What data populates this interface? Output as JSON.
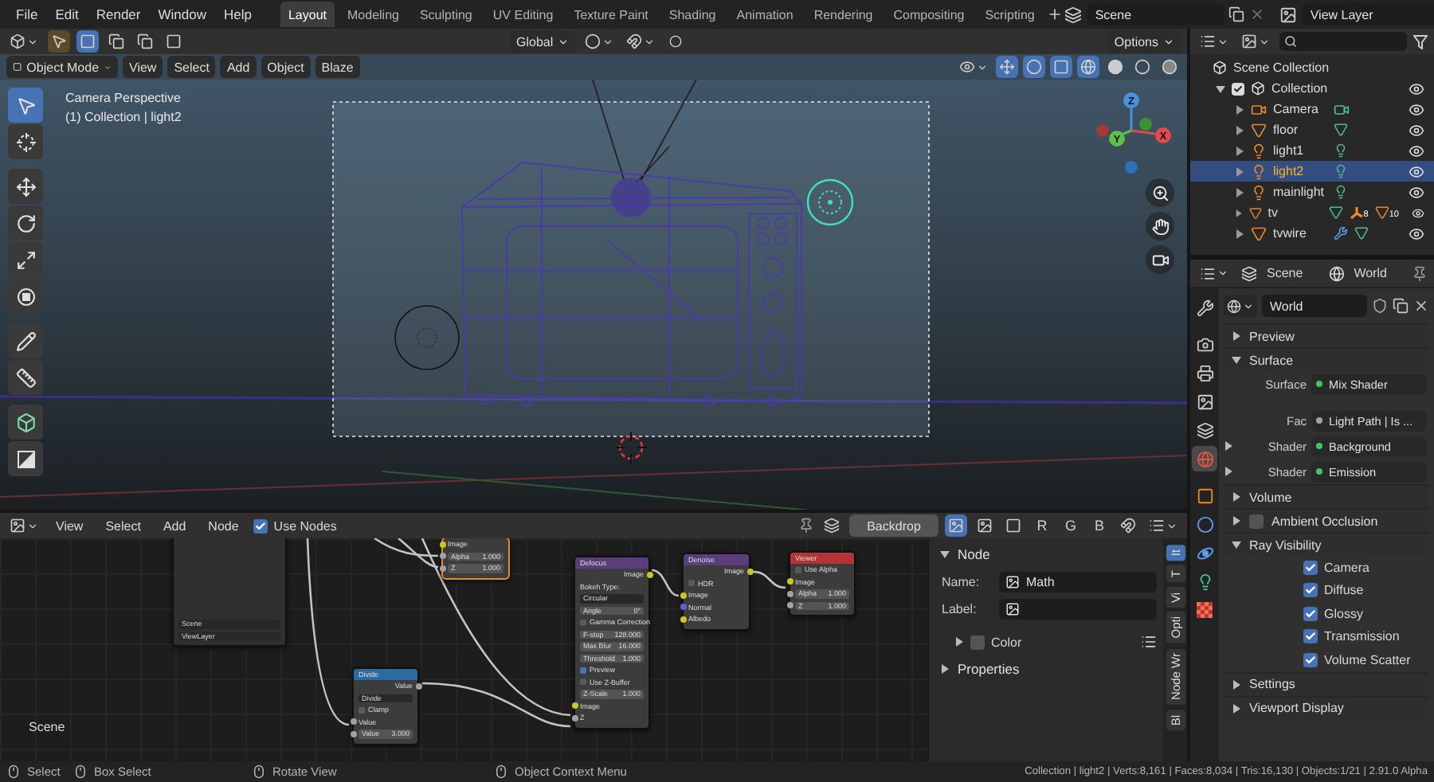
{
  "top_bar": {
    "menus": [
      "File",
      "Edit",
      "Render",
      "Window",
      "Help"
    ],
    "workspaces": [
      {
        "label": "Layout",
        "selected": true
      },
      {
        "label": "Modeling",
        "selected": false
      },
      {
        "label": "Sculpting",
        "selected": false
      },
      {
        "label": "UV Editing",
        "selected": false
      },
      {
        "label": "Texture Paint",
        "selected": false
      },
      {
        "label": "Shading",
        "selected": false
      },
      {
        "label": "Animation",
        "selected": false
      },
      {
        "label": "Rendering",
        "selected": false
      },
      {
        "label": "Compositing",
        "selected": false
      },
      {
        "label": "Scripting",
        "selected": false
      }
    ],
    "scene": "Scene",
    "view_layer": "View Layer"
  },
  "viewport": {
    "orientation": "Global",
    "options": "Options",
    "mode": "Object Mode",
    "menus": [
      "View",
      "Select",
      "Add",
      "Object",
      "Blaze"
    ],
    "title": "Camera Perspective",
    "subtitle": "(1) Collection | light2",
    "axes": [
      "Z",
      "X",
      "Y"
    ],
    "tools": [
      {
        "kind": "select",
        "selected": true
      },
      {
        "kind": "cursor",
        "selected": false
      },
      {
        "kind": "move",
        "selected": false
      },
      {
        "kind": "rotate",
        "selected": false
      },
      {
        "kind": "scale",
        "selected": false
      },
      {
        "kind": "transform",
        "selected": false
      },
      {
        "kind": "annotate",
        "selected": false
      },
      {
        "kind": "measure",
        "selected": false
      },
      {
        "kind": "add_cube",
        "selected": false
      },
      {
        "kind": "shear",
        "selected": false
      }
    ]
  },
  "outliner": {
    "root": "Scene Collection",
    "collections": [
      {
        "label": "Collection",
        "expanded": true,
        "checked": true,
        "children": [
          {
            "label": "Camera",
            "kind": "camera",
            "selected": false,
            "expanded": false,
            "extras": [
              {
                "kind": "camera_data"
              }
            ]
          },
          {
            "label": "floor",
            "kind": "mesh",
            "selected": false,
            "expanded": false,
            "extras": [
              {
                "kind": "mesh_data"
              }
            ]
          },
          {
            "label": "light1",
            "kind": "light",
            "selected": false,
            "expanded": false,
            "extras": [
              {
                "kind": "light_data"
              }
            ]
          },
          {
            "label": "light2",
            "kind": "light",
            "selected": true,
            "expanded": false,
            "extras": [
              {
                "kind": "light_data"
              }
            ]
          },
          {
            "label": "mainlight",
            "kind": "light",
            "selected": false,
            "expanded": false,
            "extras": [
              {
                "kind": "light_data"
              }
            ]
          },
          {
            "label": "tv",
            "kind": "mesh",
            "selected": false,
            "expanded": false,
            "extras": [
              {
                "kind": "mesh_data"
              },
              {
                "kind": "bone",
                "count": "8"
              },
              {
                "kind": "object",
                "count": "10"
              }
            ]
          },
          {
            "label": "tvwire",
            "kind": "mesh",
            "selected": false,
            "expanded": false,
            "extras": [
              {
                "kind": "modifier"
              },
              {
                "kind": "mesh_data"
              }
            ]
          }
        ]
      }
    ]
  },
  "properties": {
    "scene": "Scene",
    "world": "World",
    "datablock": "World",
    "tabs": [
      {
        "kind": "tool",
        "selected": false
      },
      {
        "kind": "render",
        "selected": false
      },
      {
        "kind": "output",
        "selected": false
      },
      {
        "kind": "view_layer",
        "selected": false
      },
      {
        "kind": "scene",
        "selected": false
      },
      {
        "kind": "world",
        "selected": true
      },
      {
        "kind": "object",
        "selected": false
      },
      {
        "kind": "particles",
        "selected": false
      },
      {
        "kind": "physics",
        "selected": false
      },
      {
        "kind": "light",
        "selected": false
      },
      {
        "kind": "texture",
        "selected": false
      }
    ],
    "panels": [
      {
        "title": "Preview",
        "expanded": false
      },
      {
        "title": "Surface",
        "expanded": true,
        "rows": [
          {
            "label": "Surface",
            "value": "Mix Shader",
            "color": "#3fc46a"
          },
          {
            "label": "Fac",
            "value": "Light Path | Is ...",
            "color": "#a1a1a1"
          },
          {
            "label": "Shader",
            "value": "Background",
            "color": "#3fc46a",
            "expanded": false
          },
          {
            "label": "Shader",
            "value": "Emission",
            "color": "#3fc46a",
            "expanded": false
          }
        ]
      },
      {
        "title": "Volume",
        "expanded": false
      },
      {
        "title": "Ambient Occlusion",
        "expanded": false,
        "checked": false
      },
      {
        "title": "Ray Visibility",
        "expanded": true,
        "checkboxes": [
          {
            "label": "Camera",
            "checked": true
          },
          {
            "label": "Diffuse",
            "checked": true
          },
          {
            "label": "Glossy",
            "checked": true
          },
          {
            "label": "Transmission",
            "checked": true
          },
          {
            "label": "Volume Scatter",
            "checked": true
          }
        ]
      },
      {
        "title": "Settings",
        "expanded": false
      },
      {
        "title": "Viewport Display",
        "expanded": false
      }
    ]
  },
  "node_editor": {
    "menus": [
      "View",
      "Select",
      "Add",
      "Node"
    ],
    "use_nodes": {
      "label": "Use Nodes",
      "checked": true
    },
    "backdrop": "Backdrop",
    "channels": [
      "R",
      "G",
      "B"
    ],
    "scene_label": "Scene",
    "nodes": [
      {
        "kind": "composite",
        "selected": true,
        "rows": [
          {
            "kind": "input",
            "label": "Image",
            "color": "#c7c729"
          },
          {
            "kind": "field_input",
            "label": "Alpha",
            "value": "1.000",
            "color": "#a1a1a1"
          },
          {
            "kind": "field_input",
            "label": "Z",
            "value": "1.000",
            "color": "#a1a1a1"
          }
        ]
      },
      {
        "kind": "input_node",
        "selected": false,
        "rows": [
          {
            "kind": "dropdown",
            "label": "Scene"
          },
          {
            "kind": "dropdown",
            "label": "ViewLayer"
          }
        ]
      },
      {
        "kind": "converter",
        "title": "Divide",
        "selected": false,
        "rows": [
          {
            "kind": "output",
            "label": "Value",
            "color": "#a1a1a1"
          },
          {
            "kind": "dropdown",
            "label": "Divide"
          },
          {
            "kind": "toggle",
            "label": "Clamp",
            "checked": false
          },
          {
            "kind": "input",
            "label": "Value",
            "color": "#a1a1a1"
          },
          {
            "kind": "field_input",
            "label": "Value",
            "value": "3.000",
            "color": "#a1a1a1"
          }
        ]
      },
      {
        "kind": "filter",
        "title": "Defocus",
        "selected": false,
        "rows": [
          {
            "kind": "output",
            "label": "Image",
            "color": "#c7c729"
          },
          {
            "kind": "text",
            "label": "Bokeh Type:"
          },
          {
            "kind": "dropdown",
            "label": "Circular"
          },
          {
            "kind": "field",
            "label": "Angle",
            "value": "0°"
          },
          {
            "kind": "toggle",
            "label": "Gamma Correction",
            "checked": false
          },
          {
            "kind": "field",
            "label": "F-stop",
            "value": "128.000"
          },
          {
            "kind": "field",
            "label": "Max Blur",
            "value": "16.000"
          },
          {
            "kind": "field",
            "label": "Threshold",
            "value": "1.000"
          },
          {
            "kind": "toggle",
            "label": "Preview",
            "checked": true
          },
          {
            "kind": "toggle",
            "label": "Use Z-Buffer",
            "checked": false
          },
          {
            "kind": "field",
            "label": "Z-Scale",
            "value": "1.000"
          },
          {
            "kind": "input",
            "label": "Image",
            "color": "#c7c729"
          },
          {
            "kind": "input",
            "label": "Z",
            "color": "#a1a1a1"
          }
        ]
      },
      {
        "kind": "filter",
        "title": "Denoise",
        "selected": false,
        "rows": [
          {
            "kind": "output",
            "label": "Image",
            "color": "#c7c729"
          },
          {
            "kind": "toggle",
            "label": "HDR",
            "checked": false
          },
          {
            "kind": "input",
            "label": "Image",
            "color": "#c7c729"
          },
          {
            "kind": "input",
            "label": "Normal",
            "color": "#6363c7"
          },
          {
            "kind": "input",
            "label": "Albedo",
            "color": "#c7c729"
          }
        ]
      },
      {
        "kind": "output",
        "title": "Viewer",
        "selected": false,
        "rows": [
          {
            "kind": "toggle",
            "label": "Use Alpha",
            "checked": false
          },
          {
            "kind": "input",
            "label": "Image",
            "color": "#c7c729"
          },
          {
            "kind": "field_input",
            "label": "Alpha",
            "value": "1.000",
            "color": "#a1a1a1"
          },
          {
            "kind": "field_input",
            "label": "Z",
            "value": "1.000",
            "color": "#a1a1a1"
          }
        ]
      }
    ],
    "sidebar": {
      "panel": "Node",
      "expanded": true,
      "name_label": "Name:",
      "name": "Math",
      "label_label": "Label:",
      "color": {
        "label": "Color",
        "checked": false,
        "expanded": false
      },
      "properties": {
        "label": "Properties",
        "expanded": false
      }
    },
    "tabs": [
      {
        "label": "It",
        "selected": true
      },
      {
        "label": "T",
        "selected": false
      },
      {
        "label": "Vi",
        "selected": false
      },
      {
        "label": "Opti",
        "selected": false
      },
      {
        "label": "Node Wr",
        "selected": false
      },
      {
        "label": "Bl",
        "selected": false
      }
    ]
  },
  "status_bar": {
    "hints": [
      "Select",
      "Box Select",
      "Rotate View",
      "Object Context Menu"
    ],
    "stats": "Collection | light2 | Verts:8,161 | Faces:8,034 | Tris:16,130 | Objects:1/21 | 2.91.0 Alpha"
  }
}
